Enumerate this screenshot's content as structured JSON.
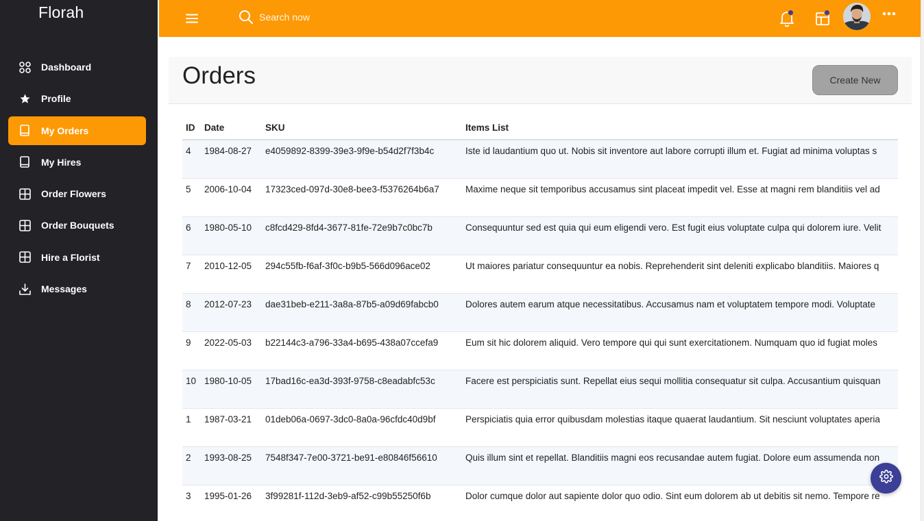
{
  "brand": "Florah",
  "sidebar": {
    "items": [
      {
        "label": "Dashboard",
        "icon": "grid-circles-icon",
        "active": false
      },
      {
        "label": "Profile",
        "icon": "star-icon",
        "active": false
      },
      {
        "label": "My Orders",
        "icon": "book-icon",
        "active": true
      },
      {
        "label": "My Hires",
        "icon": "book-icon",
        "active": false
      },
      {
        "label": "Order Flowers",
        "icon": "grid-icon",
        "active": false
      },
      {
        "label": "Order Bouquets",
        "icon": "grid-icon",
        "active": false
      },
      {
        "label": "Hire a Florist",
        "icon": "grid-icon",
        "active": false
      },
      {
        "label": "Messages",
        "icon": "download-icon",
        "active": false
      }
    ]
  },
  "header": {
    "search_placeholder": "Search now",
    "icons": [
      "menu-icon",
      "search-icon",
      "bell-icon",
      "layout-icon",
      "avatar",
      "more-icon"
    ]
  },
  "page": {
    "title": "Orders",
    "create_label": "Create New"
  },
  "table": {
    "columns": [
      "ID",
      "Date",
      "SKU",
      "Items List"
    ],
    "rows": [
      {
        "id": "4",
        "date": "1984-08-27",
        "sku": "e4059892-8399-39e3-9f9e-b54d2f7f3b4c",
        "items": "Iste id laudantium quo ut. Nobis sit inventore aut labore corrupti illum et. Fugiat ad minima voluptas s"
      },
      {
        "id": "5",
        "date": "2006-10-04",
        "sku": "17323ced-097d-30e8-bee3-f5376264b6a7",
        "items": "Maxime neque sit temporibus accusamus sint placeat impedit vel. Esse at magni rem blanditiis vel ad"
      },
      {
        "id": "6",
        "date": "1980-05-10",
        "sku": "c8fcd429-8fd4-3677-81fe-72e9b7c0bc7b",
        "items": "Consequuntur sed est quia qui eum eligendi vero. Est fugit eius voluptate culpa qui dolorem iure. Velit"
      },
      {
        "id": "7",
        "date": "2010-12-05",
        "sku": "294c55fb-f6af-3f0c-b9b5-566d096ace02",
        "items": "Ut maiores pariatur consequuntur ea nobis. Reprehenderit sint deleniti explicabo blanditiis. Maiores q"
      },
      {
        "id": "8",
        "date": "2012-07-23",
        "sku": "dae31beb-e211-3a8a-87b5-a09d69fabcb0",
        "items": "Dolores autem earum atque necessitatibus. Accusamus nam et voluptatem tempore modi. Voluptate"
      },
      {
        "id": "9",
        "date": "2022-05-03",
        "sku": "b22144c3-a796-33a4-b695-438a07ccefa9",
        "items": "Eum sit hic dolorem aliquid. Vero tempore qui qui sunt exercitationem. Numquam quo id fugiat moles"
      },
      {
        "id": "10",
        "date": "1980-10-05",
        "sku": "17bad16c-ea3d-393f-9758-c8eadabfc53c",
        "items": "Facere est perspiciatis sunt. Repellat eius sequi mollitia consequatur sit culpa. Accusantium quisquan"
      },
      {
        "id": "1",
        "date": "1987-03-21",
        "sku": "01deb06a-0697-3dc0-8a0a-96cfdc40d9bf",
        "items": "Perspiciatis quia error quibusdam molestias itaque quaerat laudantium. Sit nesciunt voluptates aperia"
      },
      {
        "id": "2",
        "date": "1993-08-25",
        "sku": "7548f347-7e00-3721-be91-e80846f56610",
        "items": "Quis illum sint et repellat. Blanditiis magni eos recusandae autem fugiat. Dolore eum assumenda non"
      },
      {
        "id": "3",
        "date": "1995-01-26",
        "sku": "3f99281f-112d-3eb9-af52-c99b55250f6b",
        "items": "Dolor cumque dolor aut sapiente dolor quo odio. Sint eum dolorem ab ut debitis sit nemo. Tempore re"
      }
    ]
  },
  "colors": {
    "accent": "#fd9904",
    "sidebar_bg": "#222227",
    "fab_bg": "#3b3f96",
    "notification_dot": "#3a3f9a"
  }
}
